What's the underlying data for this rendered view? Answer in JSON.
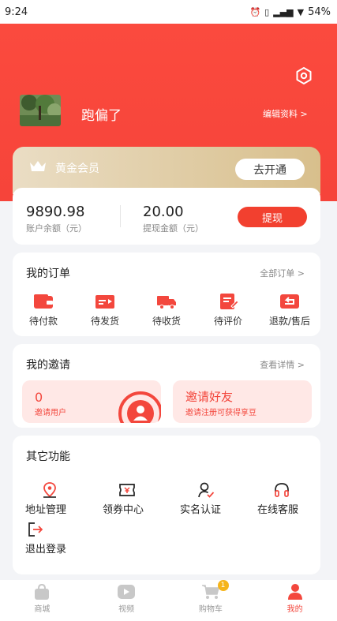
{
  "status_bar": {
    "time": "9:24",
    "battery": "54%"
  },
  "profile": {
    "username": "跑偏了",
    "edit_label": "编辑资料 >"
  },
  "member": {
    "title": "黄金会员",
    "open_label": "去开通"
  },
  "balance": {
    "account_value": "9890.98",
    "account_label": "账户余额（元）",
    "withdraw_value": "20.00",
    "withdraw_label": "提现金额（元）",
    "withdraw_button": "提现"
  },
  "orders": {
    "title": "我的订单",
    "all_link": "全部订单 >",
    "items": [
      {
        "label": "待付款",
        "icon": "wallet-icon"
      },
      {
        "label": "待发货",
        "icon": "card-send-icon"
      },
      {
        "label": "待收货",
        "icon": "truck-icon"
      },
      {
        "label": "待评价",
        "icon": "edit-note-icon"
      },
      {
        "label": "退款/售后",
        "icon": "return-icon"
      }
    ]
  },
  "invite": {
    "title": "我的邀请",
    "detail_link": "查看详情 >",
    "users_count": "0",
    "users_label": "邀请用户",
    "friends_title": "邀请好友",
    "friends_sub": "邀请注册可获得享豆"
  },
  "other": {
    "title": "其它功能",
    "items": [
      {
        "label": "地址管理",
        "icon": "location-icon"
      },
      {
        "label": "领券中心",
        "icon": "coupon-icon"
      },
      {
        "label": "实名认证",
        "icon": "verify-user-icon"
      },
      {
        "label": "在线客服",
        "icon": "headset-icon"
      },
      {
        "label": "退出登录",
        "icon": "logout-icon"
      }
    ]
  },
  "tabbar": {
    "items": [
      {
        "label": "商城",
        "icon": "shop-bag-icon"
      },
      {
        "label": "视频",
        "icon": "video-icon"
      },
      {
        "label": "购物车",
        "icon": "cart-icon",
        "badge": "1"
      },
      {
        "label": "我的",
        "icon": "user-icon",
        "active": true
      }
    ]
  },
  "colors": {
    "brand_red": "#f3473d",
    "gold_start": "#eaddc4",
    "gold_end": "#d8bf8c",
    "badge_yellow": "#f5b41b"
  }
}
